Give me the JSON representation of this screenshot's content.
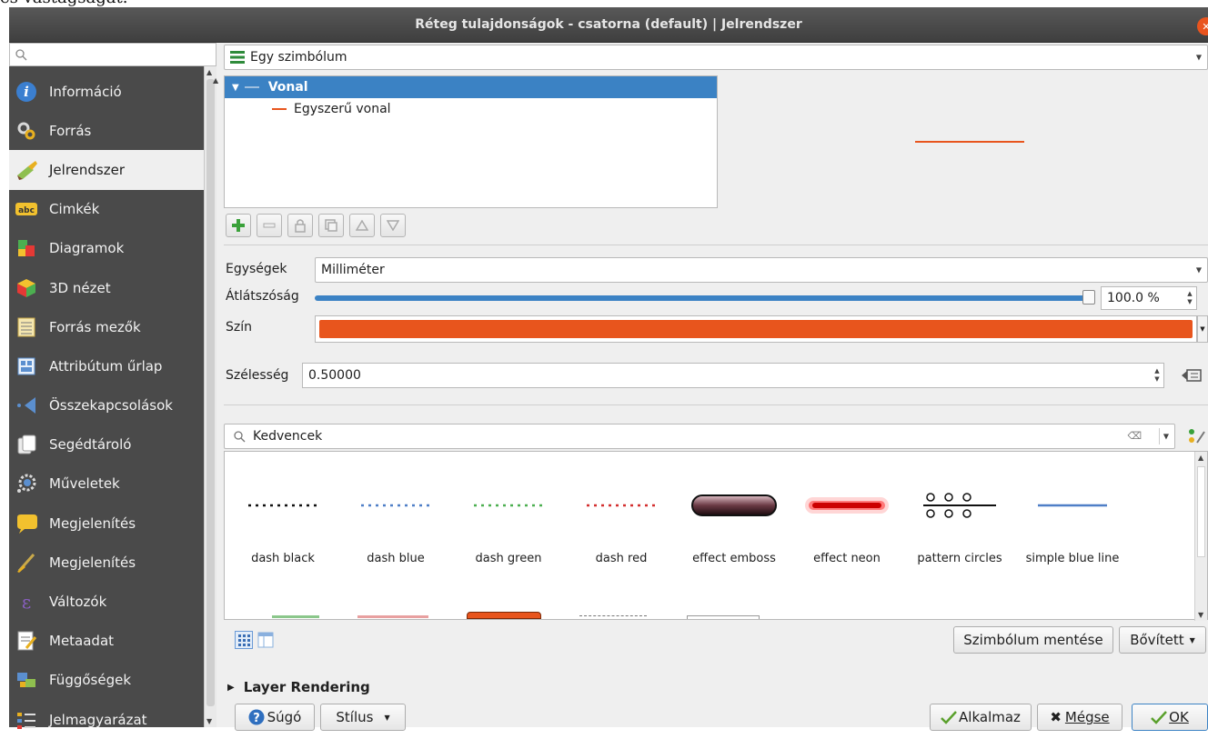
{
  "page_text": "és vastagságát.",
  "window": {
    "title": "Réteg tulajdonságok - csatorna (default) | Jelrendszer"
  },
  "sidebar": {
    "items": [
      {
        "label": "Információ",
        "icon": "info-icon"
      },
      {
        "label": "Forrás",
        "icon": "source-icon"
      },
      {
        "label": "Jelrendszer",
        "icon": "symbology-icon",
        "active": true
      },
      {
        "label": "Cimkék",
        "icon": "labels-icon"
      },
      {
        "label": "Diagramok",
        "icon": "diagrams-icon"
      },
      {
        "label": "3D nézet",
        "icon": "3d-view-icon"
      },
      {
        "label": "Forrás mezők",
        "icon": "source-fields-icon"
      },
      {
        "label": "Attribútum űrlap",
        "icon": "attribute-form-icon"
      },
      {
        "label": "Összekapcsolások",
        "icon": "joins-icon"
      },
      {
        "label": "Segédtároló",
        "icon": "auxiliary-storage-icon"
      },
      {
        "label": "Műveletek",
        "icon": "actions-icon"
      },
      {
        "label": "Megjelenítés",
        "icon": "display-icon"
      },
      {
        "label": "Megjelenítés",
        "icon": "rendering-icon"
      },
      {
        "label": "Változók",
        "icon": "variables-icon"
      },
      {
        "label": "Metaadat",
        "icon": "metadata-icon"
      },
      {
        "label": "Függőségek",
        "icon": "dependencies-icon"
      },
      {
        "label": "Jelmagyarázat",
        "icon": "legend-icon"
      }
    ]
  },
  "renderer": {
    "type": "Egy szimbólum"
  },
  "tree": {
    "root": "Vonal",
    "child": "Egyszerű vonal"
  },
  "props": {
    "units_label": "Egységek",
    "units_value": "Milliméter",
    "opacity_label": "Átlátszóság",
    "opacity_value": "100.0 %",
    "opacity_fraction": 1.0,
    "color_label": "Szín",
    "color_value": "#e8551d",
    "width_label": "Szélesség",
    "width_value": "0.50000"
  },
  "library": {
    "search_value": "Kedvencek",
    "symbols": [
      {
        "name": "dash  black",
        "style": "dash-black"
      },
      {
        "name": "dash blue",
        "style": "dash-blue"
      },
      {
        "name": "dash green",
        "style": "dash-green"
      },
      {
        "name": "dash red",
        "style": "dash-red"
      },
      {
        "name": "effect emboss",
        "style": "emboss"
      },
      {
        "name": "effect neon",
        "style": "neon"
      },
      {
        "name": "pattern circles",
        "style": "circles"
      },
      {
        "name": "simple blue line",
        "style": "blue-line"
      }
    ]
  },
  "buttons": {
    "save_symbol": "Szimbólum mentése",
    "advanced": "Bővített",
    "help": "Súgó",
    "style": "Stílus",
    "apply": "Alkalmaz",
    "cancel": "Mégse",
    "ok": "OK"
  },
  "section": {
    "layer_rendering": "Layer Rendering"
  }
}
